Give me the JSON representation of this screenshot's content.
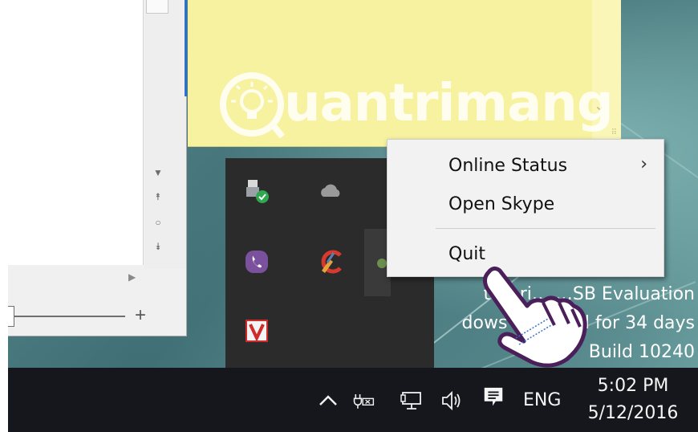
{
  "context_menu": {
    "items": [
      {
        "label": "Online Status",
        "has_submenu": true
      },
      {
        "label": "Open Skype",
        "has_submenu": false
      },
      {
        "label": "Quit",
        "has_submenu": false
      }
    ]
  },
  "tray_overflow_icons": [
    "safely-remove-hardware-icon",
    "onedrive-cloud-icon",
    "network-adapter-icon",
    "viber-icon",
    "ccleaner-icon",
    "skype-icon",
    "antivirus-v-icon"
  ],
  "desktop_watermark": {
    "line1": "terpri… …SB Evaluation",
    "line2": "dows Lic… …d for 34 days",
    "line3": "Build 10240"
  },
  "taskbar": {
    "language": "ENG",
    "time": "5:02 PM",
    "date": "5/12/2016",
    "icons": [
      "show-hidden-icons-chevron-icon",
      "power-battery-icon",
      "network-icon",
      "volume-icon",
      "action-center-icon"
    ]
  },
  "watermark": {
    "text": "uantrimang"
  },
  "colors": {
    "taskbar": "#16171c",
    "tray_panel": "#2b2b2b",
    "menu_background": "#f2f2f2",
    "sticky_note": "#f7f2a0"
  }
}
